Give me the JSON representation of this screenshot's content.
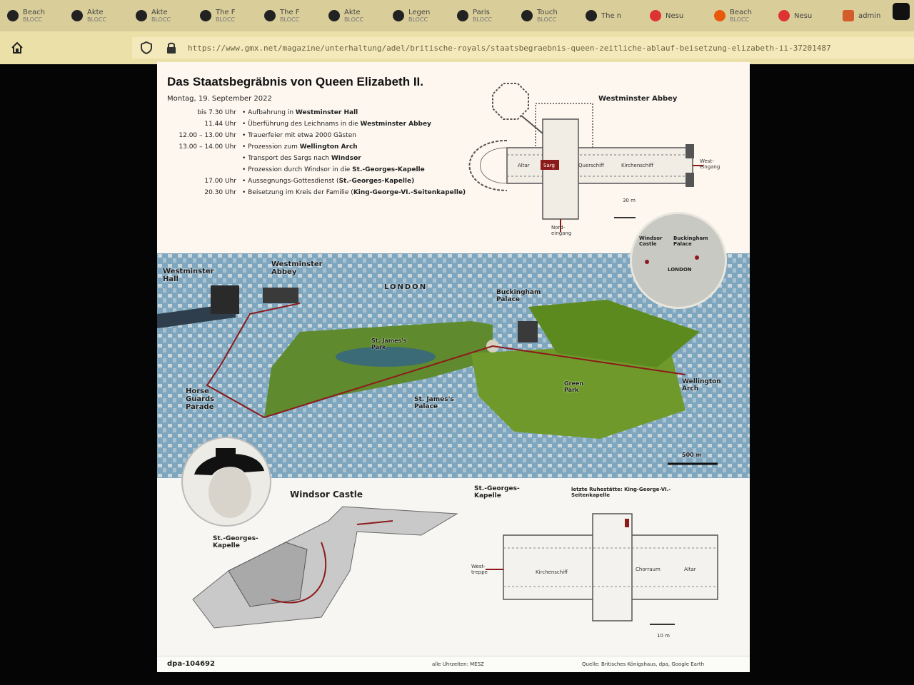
{
  "browser": {
    "tabs": [
      {
        "label": "Beach",
        "sub": "BLOCC",
        "icon": "globe-icon"
      },
      {
        "label": "Akte",
        "sub": "BLOCC",
        "icon": "globe-icon"
      },
      {
        "label": "Akte",
        "sub": "BLOCC",
        "icon": "globe-icon"
      },
      {
        "label": "The F",
        "sub": "BLOCC",
        "icon": "globe-icon"
      },
      {
        "label": "The F",
        "sub": "BLOCC",
        "icon": "globe-icon"
      },
      {
        "label": "Akte",
        "sub": "BLOCC",
        "icon": "globe-icon"
      },
      {
        "label": "Legen",
        "sub": "BLOCC",
        "icon": "globe-icon"
      },
      {
        "label": "Paris",
        "sub": "BLOCC",
        "icon": "globe-icon"
      },
      {
        "label": "Touch",
        "sub": "BLOCC",
        "icon": "globe-icon"
      },
      {
        "label": "The n",
        "sub": "",
        "icon": "globe-icon"
      },
      {
        "label": "Nesu",
        "sub": "",
        "icon": "news-icon"
      },
      {
        "label": "Beach",
        "sub": "BLOCC",
        "icon": "media-icon"
      },
      {
        "label": "Nesu",
        "sub": "",
        "icon": "news-icon"
      },
      {
        "label": "admin",
        "sub": "",
        "icon": "page-icon"
      }
    ],
    "url": "https://www.gmx.net/magazine/unterhaltung/adel/britische-royals/staatsbegraebnis-queen-zeitliche-ablauf-beisetzung-elizabeth-ii-37201487"
  },
  "graphic": {
    "title": "Das Staatsbegräbnis von Queen Elizabeth II.",
    "date": "Montag, 19. September 2022",
    "schedule": [
      {
        "time": "bis 7.30 Uhr",
        "text": "Aufbahrung in ",
        "bold": "Westminster Hall"
      },
      {
        "time": "11.44 Uhr",
        "text": "Überführung des Leichnams in die ",
        "bold": "Westminster Abbey"
      },
      {
        "time": "12.00 – 13.00 Uhr",
        "text": "Trauerfeier mit etwa 2000 Gästen",
        "bold": ""
      },
      {
        "time": "13.00 – 14.00 Uhr",
        "text": "Prozession zum ",
        "bold": "Wellington Arch"
      },
      {
        "time": "",
        "text": "Transport des Sargs nach ",
        "bold": "Windsor"
      },
      {
        "time": "",
        "text": "Prozession durch Windsor in die ",
        "bold": "St.-Georges-Kapelle"
      },
      {
        "time": "17.00 Uhr",
        "text": "Aussegnungs-Gottesdienst (",
        "bold": "St.-Georges-Kapelle)"
      },
      {
        "time": "20.30 Uhr",
        "text": "Beisetzung im Kreis der Familie (",
        "bold": "King-George-VI.-Seitenkapelle)"
      }
    ],
    "abbey": {
      "title": "Westminster Abbey",
      "labels": {
        "altar": "Altar",
        "sarg": "Sarg",
        "crossing": "Querschiff",
        "nave": "Kirchenschiff",
        "west": "West-eingang",
        "north": "Nord-eingang",
        "scale": "30 m"
      }
    },
    "locator": {
      "windsor": "Windsor Castle",
      "palace": "Buckingham Palace",
      "london": "LONDON"
    },
    "map": {
      "london": "LONDON",
      "westminster_hall": "Westminster Hall",
      "westminster_abbey": "Westminster Abbey",
      "buckingham": "Buckingham Palace",
      "horse_guards": "Horse Guards Parade",
      "st_james_palace": "St. James's Palace",
      "st_james_park": "St. James's Park",
      "green_park": "Green Park",
      "wellington": "Wellington Arch",
      "scale": "500 m"
    },
    "windsor": {
      "title": "Windsor Castle",
      "chapel_label": "St.-Georges-Kapelle"
    },
    "chapel": {
      "title": "St.-Georges-Kapelle",
      "resting": "letzte Ruhestätte: King-George-VI.-Seitenkapelle",
      "west": "West-treppe",
      "nave": "Kirchenschiff",
      "choir": "Chorraum",
      "altar": "Altar",
      "scale": "10 m"
    },
    "footer": {
      "credit": "dpa-104692",
      "timezone": "alle Uhrzeiten: MESZ",
      "source": "Quelle: Britisches Königshaus, dpa, Google Earth"
    }
  }
}
